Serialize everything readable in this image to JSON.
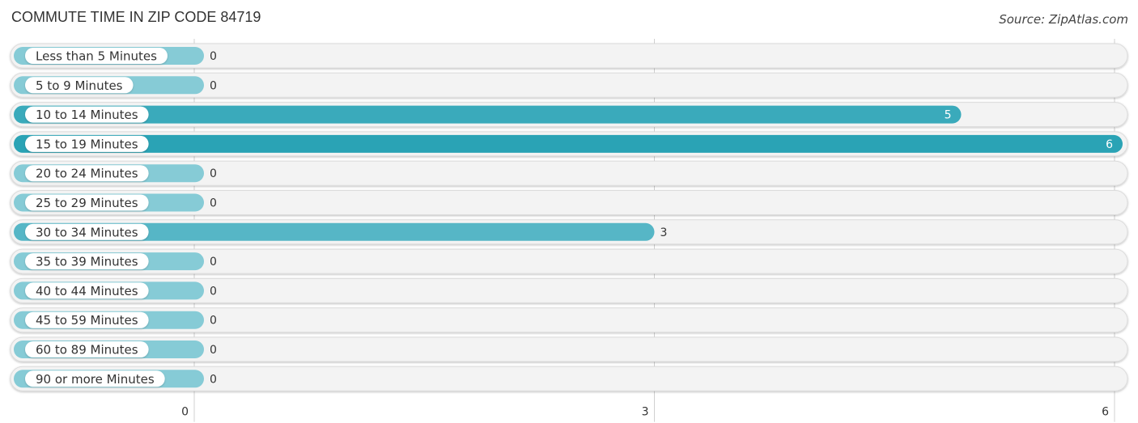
{
  "header": {
    "title": "COMMUTE TIME IN ZIP CODE 84719",
    "source": "Source: ZipAtlas.com"
  },
  "chart_data": {
    "type": "bar",
    "orientation": "horizontal",
    "title": "COMMUTE TIME IN ZIP CODE 84719",
    "xlabel": "",
    "ylabel": "",
    "categories": [
      "Less than 5 Minutes",
      "5 to 9 Minutes",
      "10 to 14 Minutes",
      "15 to 19 Minutes",
      "20 to 24 Minutes",
      "25 to 29 Minutes",
      "30 to 34 Minutes",
      "35 to 39 Minutes",
      "40 to 44 Minutes",
      "45 to 59 Minutes",
      "60 to 89 Minutes",
      "90 or more Minutes"
    ],
    "values": [
      0,
      0,
      5,
      6,
      0,
      0,
      3,
      0,
      0,
      0,
      0,
      0
    ],
    "xlim": [
      0,
      6
    ],
    "xticks": [
      0,
      3,
      6
    ],
    "grid": true,
    "colors": {
      "max": "#2aa3b5",
      "high": "#3aaabb",
      "mid": "#56b6c6",
      "zero": "#86cbd6",
      "track": "#f3f3f3"
    }
  }
}
